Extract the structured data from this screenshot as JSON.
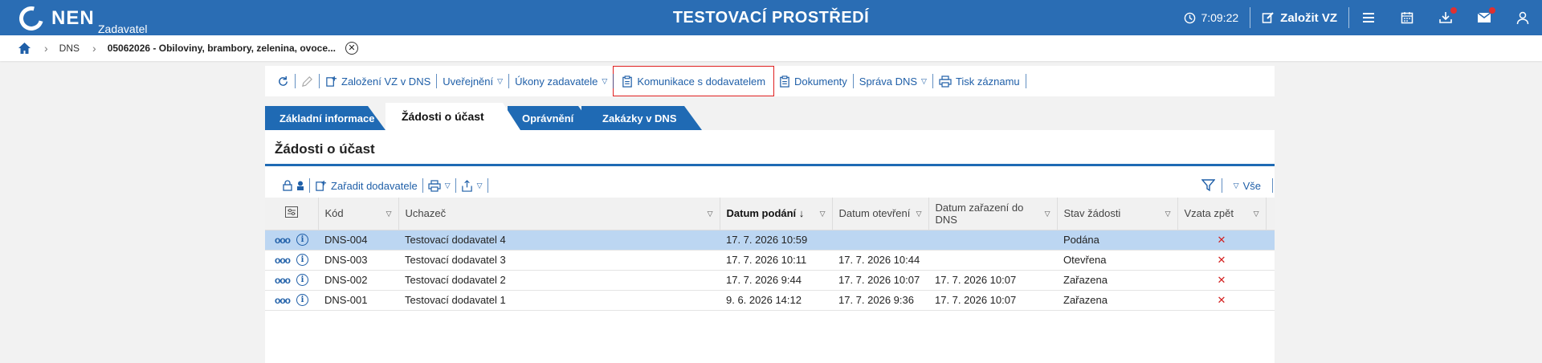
{
  "header": {
    "logo_text": "NEN",
    "logo_sub": "Zadavatel",
    "env_title": "TESTOVACÍ PROSTŘEDÍ",
    "clock": "7:09:22",
    "create_vz": "Založit VZ",
    "accent": "#2a6db4"
  },
  "breadcrumb": {
    "items": [
      "DNS"
    ],
    "current": "05062026 - Obiloviny, brambory, zelenina, ovoce..."
  },
  "toolbar": {
    "items": [
      {
        "label": "Založení VZ v DNS"
      },
      {
        "label": "Uveřejnění"
      },
      {
        "label": "Úkony zadavatele"
      },
      {
        "label": "Komunikace s dodavatelem"
      },
      {
        "label": "Dokumenty"
      },
      {
        "label": "Správa DNS"
      },
      {
        "label": "Tisk záznamu"
      }
    ]
  },
  "tabs": [
    {
      "label": "Základní informace"
    },
    {
      "label": "Žádosti o účast"
    },
    {
      "label": "Oprávnění"
    },
    {
      "label": "Zakázky v DNS"
    }
  ],
  "section": {
    "title": "Žádosti o účast",
    "assign_label": "Zařadit dodavatele",
    "all_label": "Vše"
  },
  "table": {
    "columns": [
      "Kód",
      "Uchazeč",
      "Datum podání",
      "Datum otevření",
      "Datum zařazení do DNS",
      "Stav žádosti",
      "Vzata zpět"
    ],
    "rows": [
      {
        "code": "DNS-004",
        "bidder": "Testovací dodavatel 4",
        "submitted": "17. 7. 2026 10:59",
        "opened": "",
        "assigned": "",
        "state": "Podána",
        "withdrawn": "✕"
      },
      {
        "code": "DNS-003",
        "bidder": "Testovací dodavatel 3",
        "submitted": "17. 7. 2026 10:11",
        "opened": "17. 7. 2026 10:44",
        "assigned": "",
        "state": "Otevřena",
        "withdrawn": "✕"
      },
      {
        "code": "DNS-002",
        "bidder": "Testovací dodavatel 2",
        "submitted": "17. 7. 2026 9:44",
        "opened": "17. 7. 2026 10:07",
        "assigned": "17. 7. 2026 10:07",
        "state": "Zařazena",
        "withdrawn": "✕"
      },
      {
        "code": "DNS-001",
        "bidder": "Testovací dodavatel 1",
        "submitted": "9. 6. 2026 14:12",
        "opened": "17. 7. 2026 9:36",
        "assigned": "17. 7. 2026 10:07",
        "state": "Zařazena",
        "withdrawn": "✕"
      }
    ]
  }
}
